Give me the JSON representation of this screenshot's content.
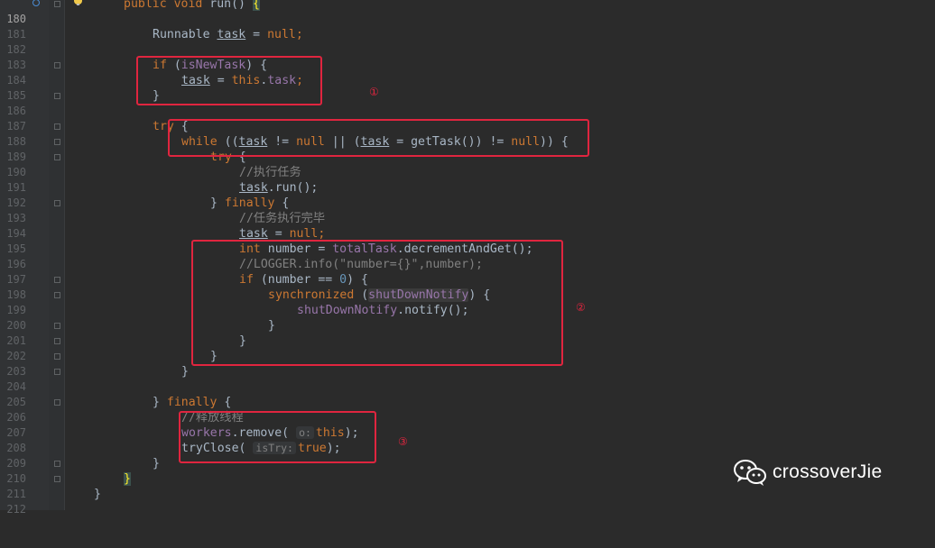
{
  "editor": {
    "line_numbers": [
      "180",
      "181",
      "182",
      "183",
      "184",
      "185",
      "186",
      "187",
      "188",
      "189",
      "190",
      "191",
      "192",
      "193",
      "194",
      "195",
      "196",
      "197",
      "198",
      "199",
      "200",
      "201",
      "202",
      "203",
      "204",
      "205",
      "206",
      "207",
      "208",
      "209",
      "210",
      "211",
      "212"
    ],
    "current_line": "180"
  },
  "code": {
    "l180": {
      "kw1": "public",
      "kw2": "void",
      "name": " run() ",
      "brace": "{"
    },
    "l182": {
      "type": "Runnable ",
      "var": "task",
      "eq": " = ",
      "kw": "null",
      "end": ";"
    },
    "l184": {
      "kw": "if",
      "p1": " (",
      "fld": "isNewTask",
      "p2": ") {"
    },
    "l185": {
      "var": "task",
      "eq": " = ",
      "kw": "this",
      "dot": ".",
      "fld": "task",
      "end": ";"
    },
    "l186": {
      "t": "}"
    },
    "l188": {
      "kw": "try",
      "t": " {"
    },
    "l189": {
      "kw": "while",
      "a": " ((",
      "var1": "task",
      "b": " != ",
      "kw2": "null",
      "c": " || (",
      "var2": "task",
      "d": " = getTask()) != ",
      "kw3": "null",
      "e": ")) {"
    },
    "l190": {
      "kw": "try",
      "t": " {"
    },
    "l191": {
      "cm": "//执行任务"
    },
    "l192": {
      "var": "task",
      "t": ".run();"
    },
    "l193": {
      "a": "} ",
      "kw": "finally",
      "b": " {"
    },
    "l194": {
      "cm": "//任务执行完毕"
    },
    "l195": {
      "var": "task",
      "eq": " = ",
      "kw": "null",
      "end": ";"
    },
    "l196": {
      "kw": "int",
      "a": " number = ",
      "fld": "totalTask",
      "b": ".decrementAndGet();"
    },
    "l197": {
      "cm": "//LOGGER.info(\"number={}\",number);"
    },
    "l198": {
      "kw": "if",
      "a": " (number == ",
      "num": "0",
      "b": ") {"
    },
    "l199": {
      "kw": "synchronized",
      "a": " (",
      "fld": "shutDownNotify",
      "b": ") {"
    },
    "l200": {
      "fld": "shutDownNotify",
      "t": ".notify();"
    },
    "l201": {
      "t": "}"
    },
    "l202": {
      "t": "}"
    },
    "l203": {
      "t": "}"
    },
    "l204": {
      "t": "}"
    },
    "l206": {
      "a": "} ",
      "kw": "finally",
      "b": " {"
    },
    "l207": {
      "cm": "//释放线程"
    },
    "l208": {
      "fld": "workers",
      "a": ".remove(",
      "hint": "o:",
      "kw": "this",
      "b": ");"
    },
    "l209": {
      "a": "tryClose(",
      "hint": "isTry:",
      "kw": "true",
      "b": ");"
    },
    "l210": {
      "t": "}"
    },
    "l211": {
      "t": "}"
    },
    "l212": {
      "t": "}"
    }
  },
  "annotations": {
    "marker1": "①",
    "marker2": "②",
    "marker3": "③",
    "color": "#e0253f"
  },
  "watermark": {
    "text": "crossoverJie",
    "icon": "wechat-icon"
  }
}
